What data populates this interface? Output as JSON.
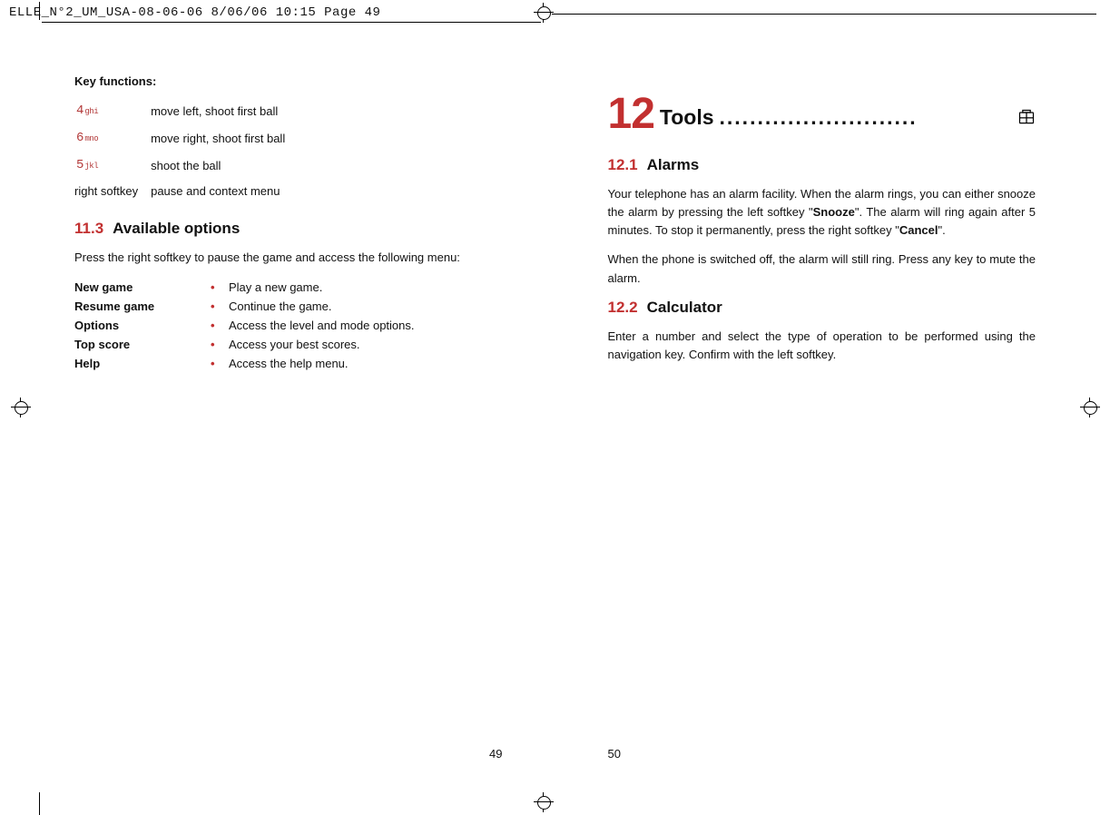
{
  "slug": "ELLE_N°2_UM_USA-08-06-06  8/06/06  10:15  Page 49",
  "left": {
    "keyfn_heading": "Key functions:",
    "keys": [
      {
        "cap_digit": "4",
        "cap_sub": "ghi",
        "desc": "move left, shoot first ball"
      },
      {
        "cap_digit": "6",
        "cap_sub": "mno",
        "desc": "move right, shoot first ball"
      },
      {
        "cap_digit": "5",
        "cap_sub": "jkl",
        "desc": "shoot the ball"
      },
      {
        "cap_plain": "right softkey",
        "desc": "pause and context menu"
      }
    ],
    "sec_num": "11.3",
    "sec_title": "Available options",
    "sec_intro": "Press the right softkey to pause the game and access the following menu:",
    "options": [
      {
        "label": "New game",
        "desc": "Play a new game."
      },
      {
        "label": "Resume game",
        "desc": "Continue the game."
      },
      {
        "label": "Options",
        "desc": "Access the level and mode options."
      },
      {
        "label": "Top score",
        "desc": "Access your best scores."
      },
      {
        "label": "Help",
        "desc": "Access the help menu."
      }
    ],
    "pagenum": "49"
  },
  "right": {
    "chapter_num": "12",
    "chapter_title": "Tools",
    "chapter_dots": "..........................",
    "sec1_num": "12.1",
    "sec1_title": "Alarms",
    "sec1_p1_a": "Your telephone has an alarm facility. When the alarm rings, you can either snooze the alarm by pressing the left softkey \"",
    "sec1_p1_b": "Snooze",
    "sec1_p1_c": "\". The alarm will ring again after 5 minutes. To stop it permanently, press the right softkey \"",
    "sec1_p1_d": "Cancel",
    "sec1_p1_e": "\".",
    "sec1_p2": "When the phone is switched off, the alarm will still ring. Press any key to mute the alarm.",
    "sec2_num": "12.2",
    "sec2_title": "Calculator",
    "sec2_p1": "Enter a number and select the type of operation to be performed using the navigation key. Confirm with the left softkey.",
    "pagenum": "50"
  }
}
